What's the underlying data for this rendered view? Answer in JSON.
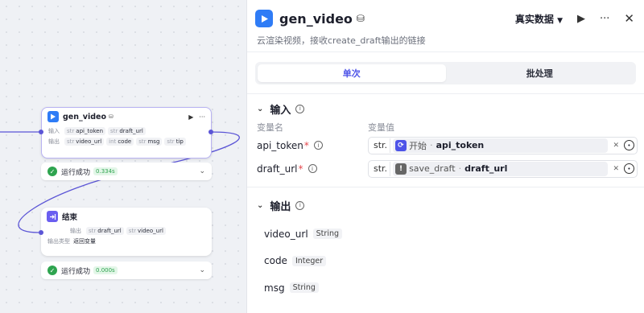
{
  "canvas": {
    "gen_node": {
      "title": "gen_video",
      "input_label": "输入",
      "output_label": "输出",
      "inputs": [
        {
          "type": "str",
          "name": "api_token"
        },
        {
          "type": "str",
          "name": "draft_url"
        }
      ],
      "outputs": [
        {
          "type": "str",
          "name": "video_url"
        },
        {
          "type": "int",
          "name": "code"
        },
        {
          "type": "str",
          "name": "msg"
        },
        {
          "type": "str",
          "name": "tip"
        }
      ]
    },
    "gen_status": {
      "text": "运行成功",
      "time": "0.334s"
    },
    "end_node": {
      "title": "结束",
      "output_label": "输出",
      "outputs": [
        {
          "type": "str",
          "name": "draft_url"
        },
        {
          "type": "str",
          "name": "video_url"
        }
      ],
      "output_type_label": "输出类型",
      "output_type_value": "返回变量"
    },
    "end_status": {
      "text": "运行成功",
      "time": "0.000s"
    }
  },
  "panel": {
    "title": "gen_video",
    "mode_label": "真实数据",
    "description": "云渲染视频，接收create_draft输出的链接",
    "tabs": [
      {
        "label": "单次",
        "active": true
      },
      {
        "label": "批处理",
        "active": false
      }
    ],
    "input_section": {
      "title": "输入",
      "col_name": "变量名",
      "col_value": "变量值",
      "rows": [
        {
          "name": "api_token",
          "required": "*",
          "type": "str.",
          "ref_node": "开始",
          "ref_field": "api_token",
          "ref_icon": "start"
        },
        {
          "name": "draft_url",
          "required": "*",
          "type": "str.",
          "ref_node": "save_draft",
          "ref_field": "draft_url",
          "ref_icon": "warn"
        }
      ]
    },
    "output_section": {
      "title": "输出",
      "rows": [
        {
          "name": "video_url",
          "type": "String"
        },
        {
          "name": "code",
          "type": "Integer"
        },
        {
          "name": "msg",
          "type": "String"
        }
      ]
    }
  },
  "colors": {
    "accent": "#4d53e8",
    "success": "#2ea44f",
    "node_icon": "#2f7cf6",
    "end_icon": "#6a5ef0",
    "required": "#e5484d"
  }
}
